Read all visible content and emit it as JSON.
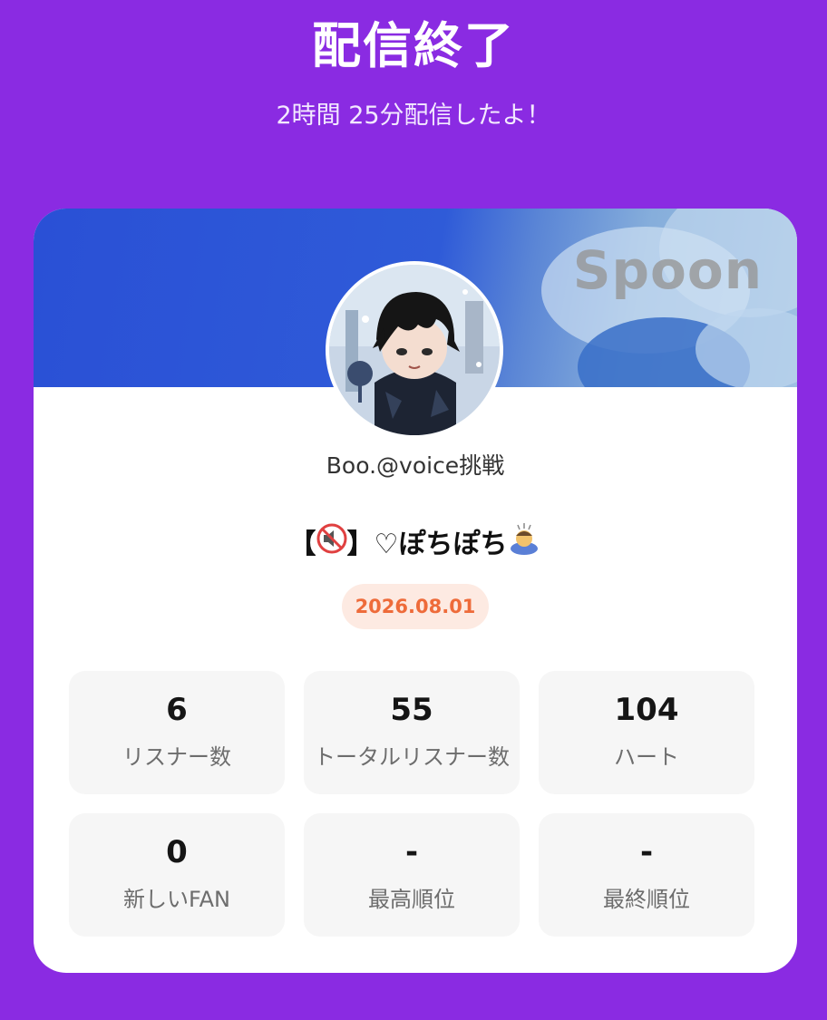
{
  "header": {
    "title": "配信終了",
    "subtitle": "2時間 25分配信したよ！"
  },
  "card": {
    "banner_watermark": "Spoon",
    "avatar_icon": "dj-avatar",
    "dj_name": "Boo.@voice挑戦",
    "live_title": {
      "prefix": "【",
      "muted_speaker_icon": "muted-speaker-icon",
      "middle": "】♡ぽちぽち",
      "bowing_person_icon": "bowing-person-icon"
    },
    "date": "2026.08.01"
  },
  "stats": [
    {
      "value": "6",
      "label": "リスナー数"
    },
    {
      "value": "55",
      "label": "トータルリスナー数"
    },
    {
      "value": "104",
      "label": "ハート"
    },
    {
      "value": "0",
      "label": "新しいFAN"
    },
    {
      "value": "-",
      "label": "最高順位"
    },
    {
      "value": "-",
      "label": "最終順位"
    }
  ],
  "colors": {
    "background": "#8a2be2",
    "card": "#ffffff",
    "banner": "#2f5bd8",
    "date_text": "#ee6b3a",
    "date_bg": "#fdeae2",
    "stat_bg": "#f6f6f6"
  }
}
